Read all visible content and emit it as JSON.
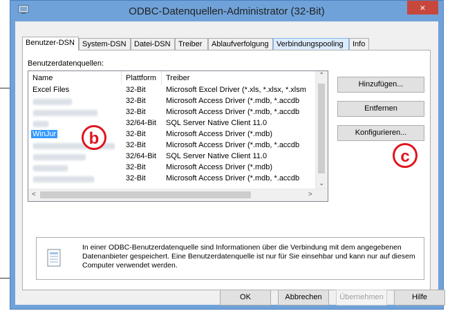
{
  "window": {
    "title": "ODBC-Datenquellen-Administrator (32-Bit)",
    "close_glyph": "×"
  },
  "tabs": [
    {
      "label": "Benutzer-DSN"
    },
    {
      "label": "System-DSN"
    },
    {
      "label": "Datei-DSN"
    },
    {
      "label": "Treiber"
    },
    {
      "label": "Ablaufverfolgung"
    },
    {
      "label": "Verbindungspooling"
    },
    {
      "label": "Info"
    }
  ],
  "list": {
    "label": "Benutzerdatenquellen:",
    "columns": [
      "Name",
      "Plattform",
      "Treiber"
    ],
    "rows": [
      {
        "name": "Excel Files",
        "platform": "32-Bit",
        "driver": "Microsoft Excel Driver (*.xls, *.xlsx, *.xlsm"
      },
      {
        "name": "",
        "platform": "32-Bit",
        "driver": "Microsoft Access Driver (*.mdb, *.accdb"
      },
      {
        "name": "",
        "platform": "32-Bit",
        "driver": "Microsoft Access Driver (*.mdb, *.accdb"
      },
      {
        "name": "",
        "platform": "32/64-Bit",
        "driver": "SQL Server Native Client 11.0"
      },
      {
        "name": "WinJur",
        "platform": "32-Bit",
        "driver": "Microsoft Access Driver (*.mdb)",
        "selected": true
      },
      {
        "name": "",
        "platform": "32-Bit",
        "driver": "Microsoft Access Driver (*.mdb, *.accdb"
      },
      {
        "name": "",
        "platform": "32/64-Bit",
        "driver": "SQL Server Native Client 11.0"
      },
      {
        "name": "",
        "platform": "32-Bit",
        "driver": "Microsoft Access Driver (*.mdb)"
      },
      {
        "name": "",
        "platform": "32-Bit",
        "driver": "Microsoft Access Driver (*.mdb, *.accdb"
      }
    ]
  },
  "side_buttons": {
    "add": "Hinzufügen...",
    "remove": "Entfernen",
    "configure": "Konfigurieren..."
  },
  "info_text": "In einer ODBC-Benutzerdatenquelle sind Informationen über die Verbindung mit dem angegebenen Datenanbieter gespeichert. Eine Benutzerdatenquelle ist nur für Sie einsehbar und kann nur auf diesem Computer verwendet werden.",
  "bottom_buttons": {
    "ok": "OK",
    "cancel": "Abbrechen",
    "apply": "Übernehmen",
    "help": "Hilfe"
  },
  "callouts": {
    "b": "b",
    "c": "c"
  },
  "colors": {
    "accent": "#3399ff",
    "close": "#c7473c",
    "callout": "#e0141e",
    "frame": "#6fa2d9"
  }
}
